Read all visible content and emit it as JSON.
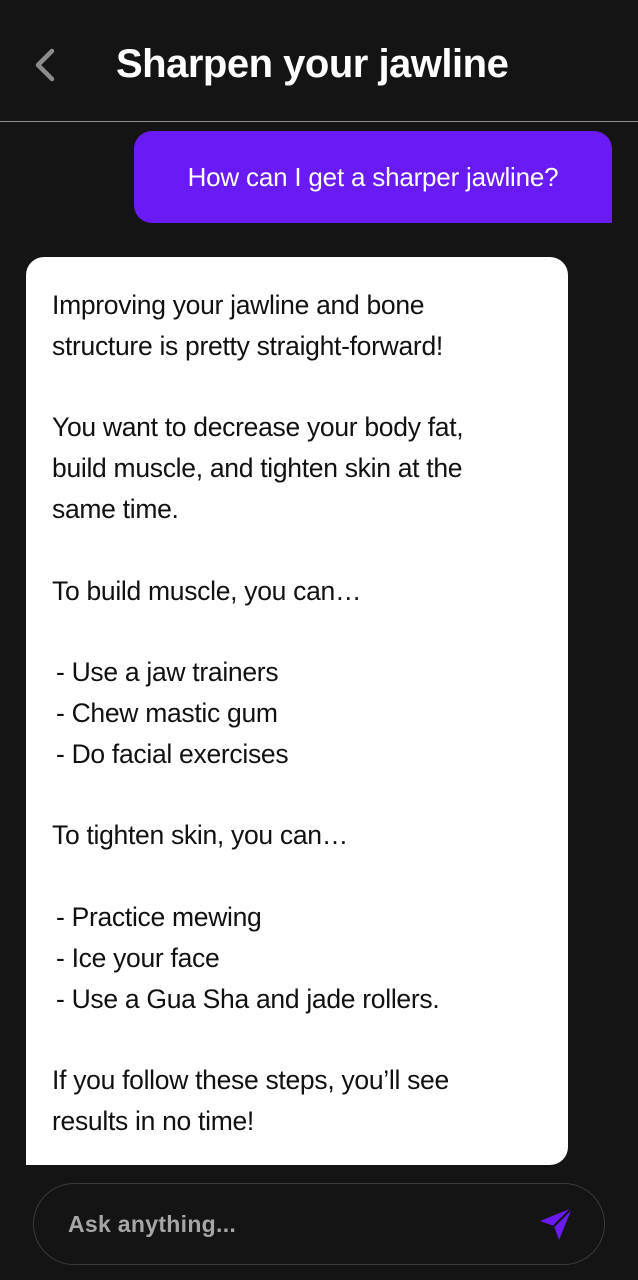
{
  "header": {
    "title": "Sharpen your jawline",
    "back_icon": "chevron-left-icon"
  },
  "conversation": {
    "user_message": "How can I get a sharper jawline?",
    "assistant_message": {
      "intro": [
        "Improving your jawline and bone",
        "structure is pretty straight-forward!"
      ],
      "goal": [
        "You want to decrease your body fat,",
        "build muscle, and tighten skin at the",
        "same time."
      ],
      "muscle_heading": "To build muscle, you can…",
      "muscle_items": [
        "- Use a jaw trainers",
        "- Chew mastic gum",
        "- Do facial exercises"
      ],
      "skin_heading": "To tighten skin, you can…",
      "skin_items": [
        "- Practice mewing",
        "- Ice your face",
        "- Use a Gua Sha and jade rollers."
      ],
      "closing": [
        "If you follow these steps, you’ll see",
        "results in no time!"
      ]
    }
  },
  "composer": {
    "placeholder": "Ask anything...",
    "send_icon": "send-icon"
  },
  "colors": {
    "background": "#141414",
    "accent": "#6a1bf5",
    "bubble": "#ffffff"
  }
}
